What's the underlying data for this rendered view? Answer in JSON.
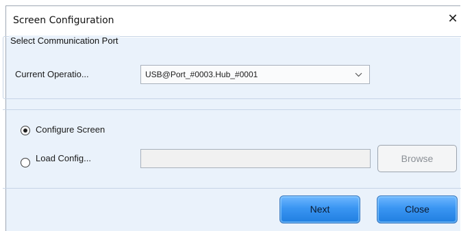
{
  "dialog": {
    "title": "Screen Configuration",
    "close_glyph": "✕"
  },
  "port_group": {
    "legend": "Select Communication Port",
    "current_operation_label": "Current Operatio...",
    "port_value": "USB@Port_#0003.Hub_#0001"
  },
  "config_group": {
    "configure_screen_label": "Configure Screen",
    "load_config_label": "Load Config...",
    "selected_option": "configure_screen",
    "path_value": "",
    "browse_label": "Browse"
  },
  "footer": {
    "next_label": "Next",
    "close_label": "Close"
  },
  "colors": {
    "panel_bg": "#eaf2fb",
    "button_blue": "#3a95f2"
  }
}
